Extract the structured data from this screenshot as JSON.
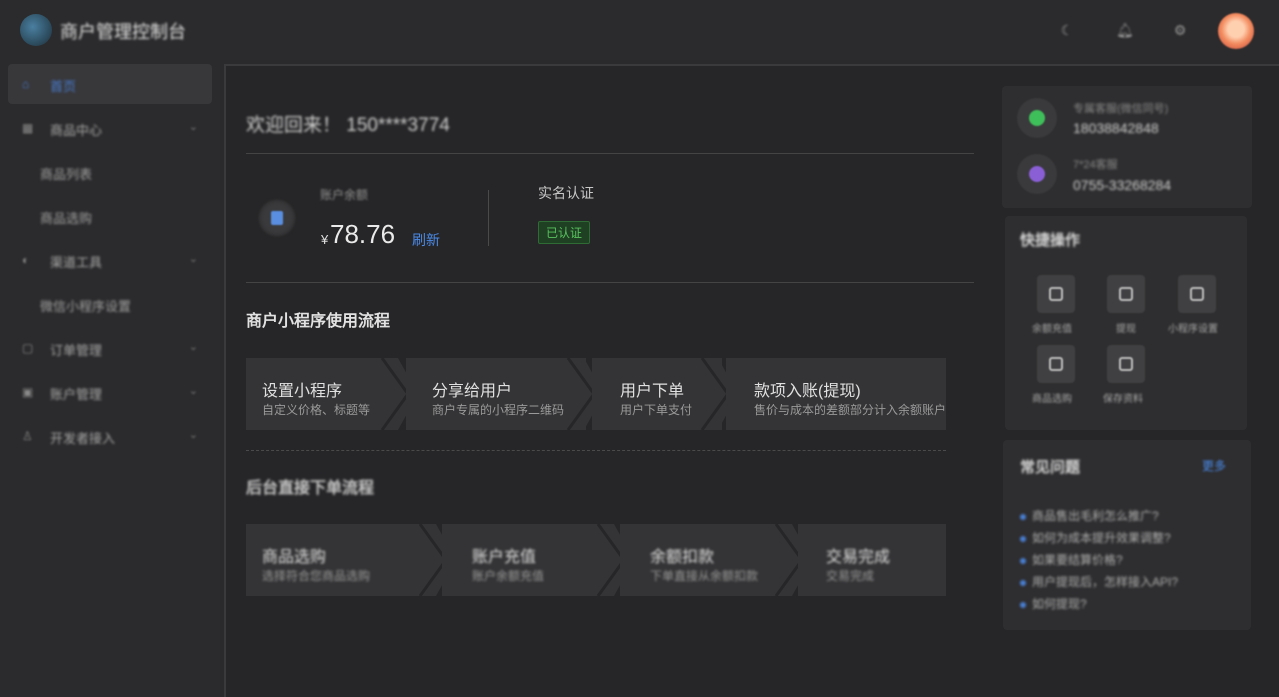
{
  "app": {
    "title": "商户管理控制台"
  },
  "topbar": {
    "icons": [
      "moon-icon",
      "bell-icon",
      "settings-icon"
    ]
  },
  "sidebar": {
    "items": [
      {
        "label": "首页",
        "icon": "home-icon",
        "active": true
      },
      {
        "label": "商品中心",
        "icon": "grid-icon",
        "expandable": true
      },
      {
        "label": "商品列表",
        "sub": true
      },
      {
        "label": "商品选购",
        "sub": true
      },
      {
        "label": "渠道工具",
        "icon": "tool-icon",
        "expandable": true
      },
      {
        "label": "微信小程序设置",
        "sub": true
      },
      {
        "label": "订单管理",
        "icon": "order-icon",
        "expandable": true
      },
      {
        "label": "账户管理",
        "icon": "account-icon",
        "expandable": true
      },
      {
        "label": "开发者接入",
        "icon": "developer-icon",
        "expandable": true
      }
    ]
  },
  "main": {
    "welcome": "欢迎回来！ 150****3774",
    "balance": {
      "label": "账户余额",
      "currency": "¥",
      "amount": "78.76",
      "refresh": "刷新"
    },
    "verification": {
      "label": "实名认证",
      "status": "已认证"
    },
    "flow1": {
      "title": "商户小程序使用流程",
      "steps": [
        {
          "title": "设置小程序",
          "desc": "自定义价格、标题等"
        },
        {
          "title": "分享给用户",
          "desc": "商户专属的小程序二维码"
        },
        {
          "title": "用户下单",
          "desc": "用户下单支付"
        },
        {
          "title": "款项入账(提现)",
          "desc": "售价与成本的差额部分计入余额账户"
        }
      ]
    },
    "flow2": {
      "title": "后台直接下单流程",
      "steps": [
        {
          "title": "商品选购",
          "desc": "选择符合您商品选购"
        },
        {
          "title": "账户充值",
          "desc": "账户余额充值"
        },
        {
          "title": "余额扣款",
          "desc": "下单直接从余额扣款"
        },
        {
          "title": "交易完成",
          "desc": "交易完成"
        }
      ]
    }
  },
  "right": {
    "contacts": [
      {
        "label": "专属客服(微信同号)",
        "value": "18038842848",
        "icon": "wechat-icon",
        "color": "#3fbf5a"
      },
      {
        "label": "7*24客服",
        "value": "0755-33268284",
        "icon": "phone-icon",
        "color": "#8a5fd6"
      }
    ],
    "quick": {
      "title": "快捷操作",
      "items": [
        {
          "label": "余额充值",
          "icon": "wallet-icon"
        },
        {
          "label": "提现",
          "icon": "withdraw-icon"
        },
        {
          "label": "小程序设置",
          "icon": "miniapp-icon"
        },
        {
          "label": "商品选购",
          "icon": "shop-icon"
        },
        {
          "label": "保存资料",
          "icon": "edit-icon"
        }
      ]
    },
    "faq": {
      "title": "常见问题",
      "more": "更多",
      "items": [
        "商品售出毛利怎么推广?",
        "如何为成本提升效果调整?",
        "如果要结算价格?",
        "用户提现后，怎样接入API?",
        "如何提现?"
      ]
    }
  }
}
